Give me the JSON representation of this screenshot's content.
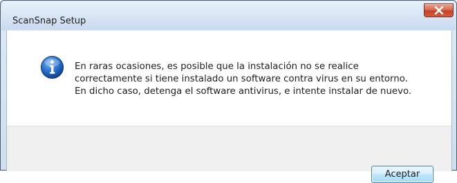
{
  "window": {
    "title": "ScanSnap Setup",
    "close_icon": "close-icon"
  },
  "dialog": {
    "icon": "info-icon",
    "message_lines": [
      "En raras ocasiones, es posible que la instalación no se realice",
      "correctamente si tiene instalado un software contra virus en su entorno.",
      "En dicho caso, detenga el software antivirus, e intente instalar de nuevo."
    ],
    "ok_label": "Aceptar"
  },
  "colors": {
    "frame": "#cfdfef",
    "close_button": "#c2422a",
    "info_icon": "#1a5fb4",
    "button_border": "#3c7fb1"
  }
}
